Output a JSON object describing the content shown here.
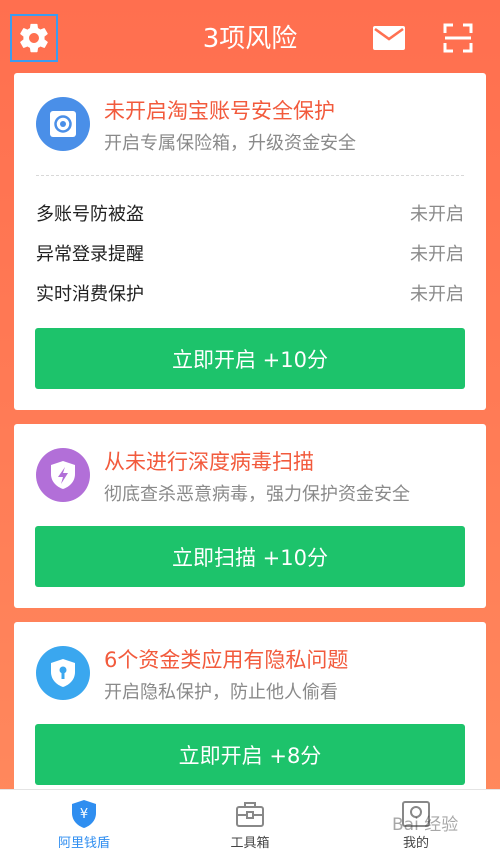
{
  "header": {
    "title": "3项风险",
    "icons": [
      "gear-icon",
      "mail-icon",
      "scan-icon"
    ]
  },
  "cards": [
    {
      "icon": "safe-box-icon",
      "icon_color": "#4a8fe8",
      "title": "未开启淘宝账号安全保护",
      "subtitle": "开启专属保险箱，升级资金安全",
      "rows": [
        {
          "label": "多账号防被盗",
          "status": "未开启"
        },
        {
          "label": "异常登录提醒",
          "status": "未开启"
        },
        {
          "label": "实时消费保护",
          "status": "未开启"
        }
      ],
      "button": "立即开启 +10分"
    },
    {
      "icon": "virus-shield-icon",
      "icon_color": "#b26fd8",
      "title": "从未进行深度病毒扫描",
      "subtitle": "彻底查杀恶意病毒，强力保护资金安全",
      "button": "立即扫描 +10分"
    },
    {
      "icon": "privacy-shield-icon",
      "icon_color": "#3aa7ef",
      "title": "6个资金类应用有隐私问题",
      "subtitle": "开启隐私保护，防止他人偷看",
      "button": "立即开启 +8分"
    }
  ],
  "tabbar": {
    "tabs": [
      {
        "label": "阿里钱盾",
        "icon": "yuan-shield-icon",
        "active": true
      },
      {
        "label": "工具箱",
        "icon": "toolbox-icon",
        "active": false
      },
      {
        "label": "我的",
        "icon": "profile-icon",
        "active": false
      }
    ]
  },
  "watermark": "Bai 经验",
  "colors": {
    "background": "#ff7152",
    "title_red": "#f25a3c",
    "button_green": "#1dc36b",
    "active_blue": "#2f8ef0"
  }
}
